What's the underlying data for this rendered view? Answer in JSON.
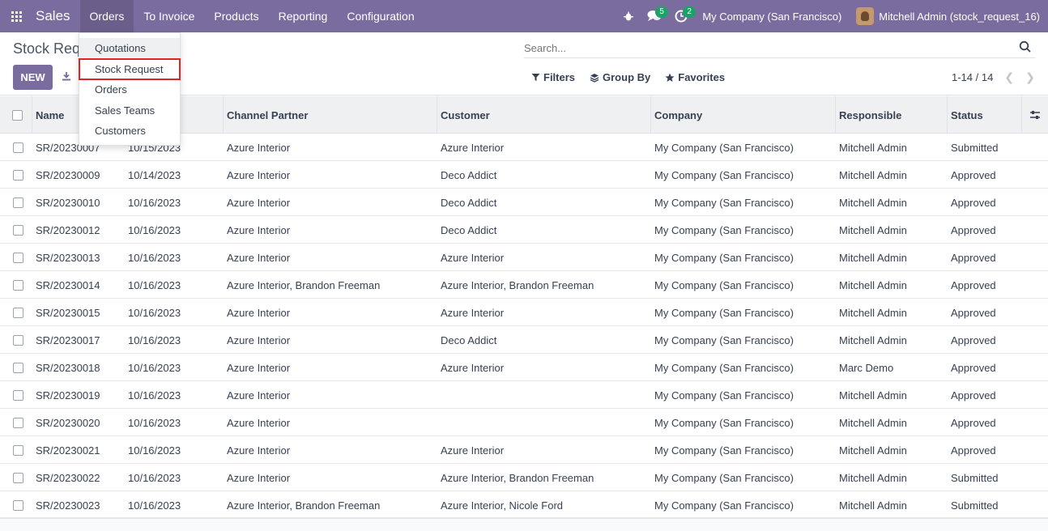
{
  "navbar": {
    "app_name": "Sales",
    "menus": [
      "Orders",
      "To Invoice",
      "Products",
      "Reporting",
      "Configuration"
    ],
    "messages_count": "5",
    "activities_count": "2",
    "company": "My Company (San Francisco)",
    "user": "Mitchell Admin (stock_request_16)",
    "bar_color": "#7a6c9f"
  },
  "control": {
    "title": "Stock Req",
    "new_label": "NEW",
    "search_placeholder": "Search...",
    "filters_label": "Filters",
    "group_by_label": "Group By",
    "favorites_label": "Favorites",
    "pager": "1-14 / 14"
  },
  "dropdown": {
    "items": [
      "Quotations",
      "Stock Request",
      "Orders",
      "Sales Teams",
      "Customers"
    ]
  },
  "table": {
    "columns": [
      "Name",
      "",
      "Channel Partner",
      "Customer",
      "Company",
      "Responsible",
      "Status"
    ],
    "rows": [
      [
        "SR/20230007",
        "10/15/2023",
        "Azure Interior",
        "Azure Interior",
        "My Company (San Francisco)",
        "Mitchell Admin",
        "Submitted"
      ],
      [
        "SR/20230009",
        "10/14/2023",
        "Azure Interior",
        "Deco Addict",
        "My Company (San Francisco)",
        "Mitchell Admin",
        "Approved"
      ],
      [
        "SR/20230010",
        "10/16/2023",
        "Azure Interior",
        "Deco Addict",
        "My Company (San Francisco)",
        "Mitchell Admin",
        "Approved"
      ],
      [
        "SR/20230012",
        "10/16/2023",
        "Azure Interior",
        "Deco Addict",
        "My Company (San Francisco)",
        "Mitchell Admin",
        "Approved"
      ],
      [
        "SR/20230013",
        "10/16/2023",
        "Azure Interior",
        "Azure Interior",
        "My Company (San Francisco)",
        "Mitchell Admin",
        "Approved"
      ],
      [
        "SR/20230014",
        "10/16/2023",
        "Azure Interior, Brandon Freeman",
        "Azure Interior, Brandon Freeman",
        "My Company (San Francisco)",
        "Mitchell Admin",
        "Approved"
      ],
      [
        "SR/20230015",
        "10/16/2023",
        "Azure Interior",
        "Azure Interior",
        "My Company (San Francisco)",
        "Mitchell Admin",
        "Approved"
      ],
      [
        "SR/20230017",
        "10/16/2023",
        "Azure Interior",
        "Deco Addict",
        "My Company (San Francisco)",
        "Mitchell Admin",
        "Approved"
      ],
      [
        "SR/20230018",
        "10/16/2023",
        "Azure Interior",
        "Azure Interior",
        "My Company (San Francisco)",
        "Marc Demo",
        "Approved"
      ],
      [
        "SR/20230019",
        "10/16/2023",
        "Azure Interior",
        "",
        "My Company (San Francisco)",
        "Mitchell Admin",
        "Approved"
      ],
      [
        "SR/20230020",
        "10/16/2023",
        "Azure Interior",
        "",
        "My Company (San Francisco)",
        "Mitchell Admin",
        "Approved"
      ],
      [
        "SR/20230021",
        "10/16/2023",
        "Azure Interior",
        "Azure Interior",
        "My Company (San Francisco)",
        "Mitchell Admin",
        "Approved"
      ],
      [
        "SR/20230022",
        "10/16/2023",
        "Azure Interior",
        "Azure Interior, Brandon Freeman",
        "My Company (San Francisco)",
        "Mitchell Admin",
        "Submitted"
      ],
      [
        "SR/20230023",
        "10/16/2023",
        "Azure Interior, Brandon Freeman",
        "Azure Interior, Nicole Ford",
        "My Company (San Francisco)",
        "Mitchell Admin",
        "Submitted"
      ]
    ]
  }
}
